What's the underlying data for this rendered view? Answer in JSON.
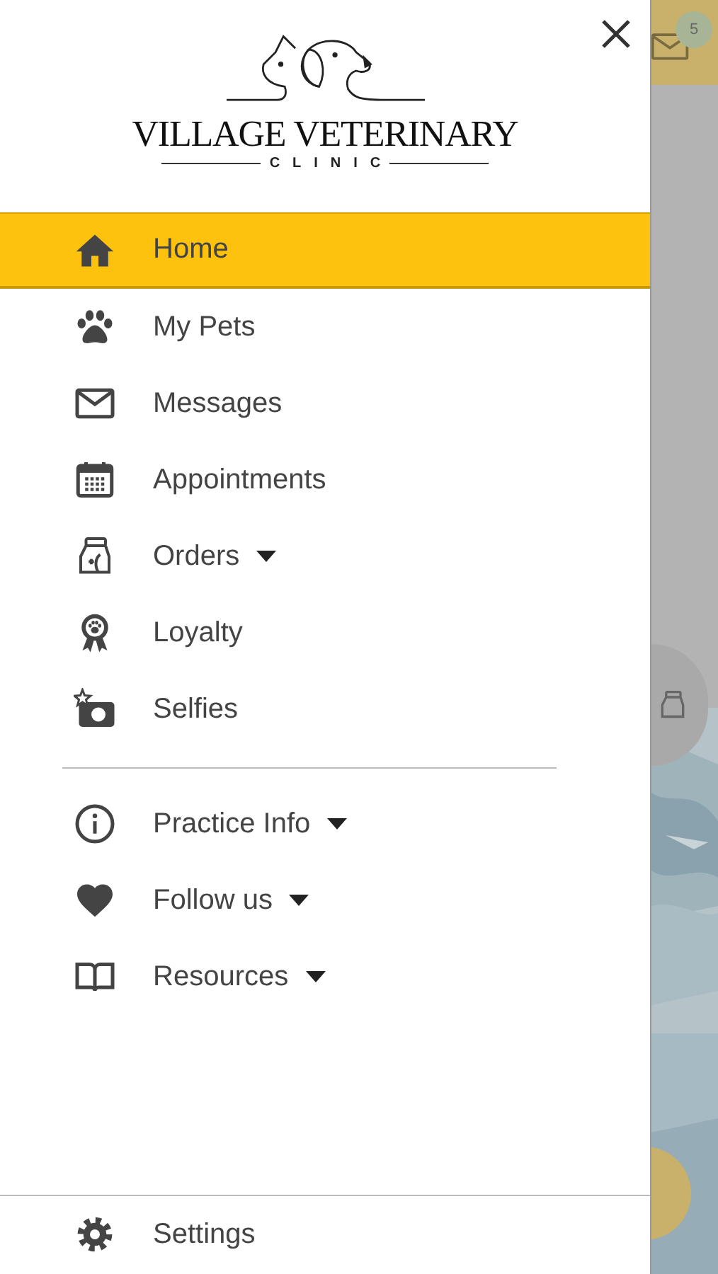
{
  "logo": {
    "name": "VILLAGE VETERINARY",
    "subtitle": "CLINIC"
  },
  "menu": [
    {
      "label": "Home",
      "selected": true,
      "expandable": false
    },
    {
      "label": "My Pets",
      "selected": false,
      "expandable": false
    },
    {
      "label": "Messages",
      "selected": false,
      "expandable": false
    },
    {
      "label": "Appointments",
      "selected": false,
      "expandable": false
    },
    {
      "label": "Orders",
      "selected": false,
      "expandable": true
    },
    {
      "label": "Loyalty",
      "selected": false,
      "expandable": false
    },
    {
      "label": "Selfies",
      "selected": false,
      "expandable": false
    }
  ],
  "more_menu": [
    {
      "label": "Practice Info",
      "selected": false,
      "expandable": true
    },
    {
      "label": "Follow us",
      "selected": false,
      "expandable": true
    },
    {
      "label": "Resources",
      "selected": false,
      "expandable": true
    }
  ],
  "footer_menu": [
    {
      "label": "Settings",
      "selected": false,
      "expandable": false
    }
  ],
  "background": {
    "message_badge": "5"
  }
}
